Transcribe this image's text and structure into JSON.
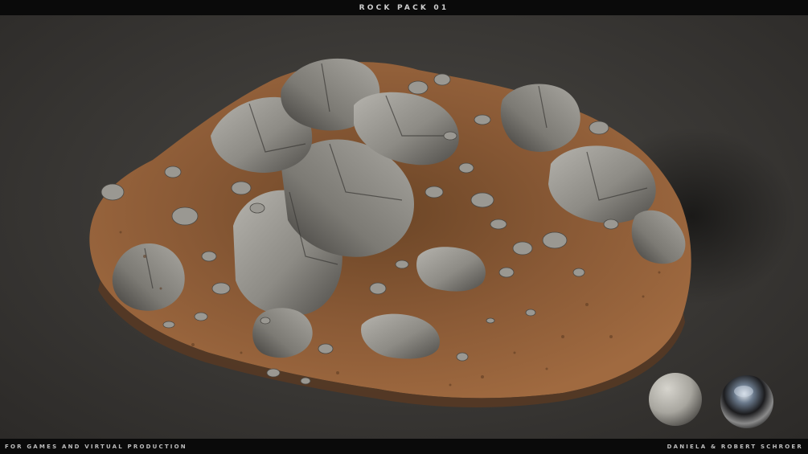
{
  "header": {
    "title": "ROCK PACK 01"
  },
  "footer": {
    "left_text": "FOR GAMES AND VIRTUAL PRODUCTION",
    "right_text": "DANIELA & ROBERT SCHROER"
  },
  "scene": {
    "subject": "rock-pile-on-dirt-mound",
    "material_spheres": [
      "matte-gray-sphere",
      "chrome-sphere"
    ]
  },
  "colors": {
    "bar": "#0a0a0a",
    "backdrop": "#3c3a37",
    "dirt": "#8a5a36",
    "rock": "#8e8c86"
  }
}
